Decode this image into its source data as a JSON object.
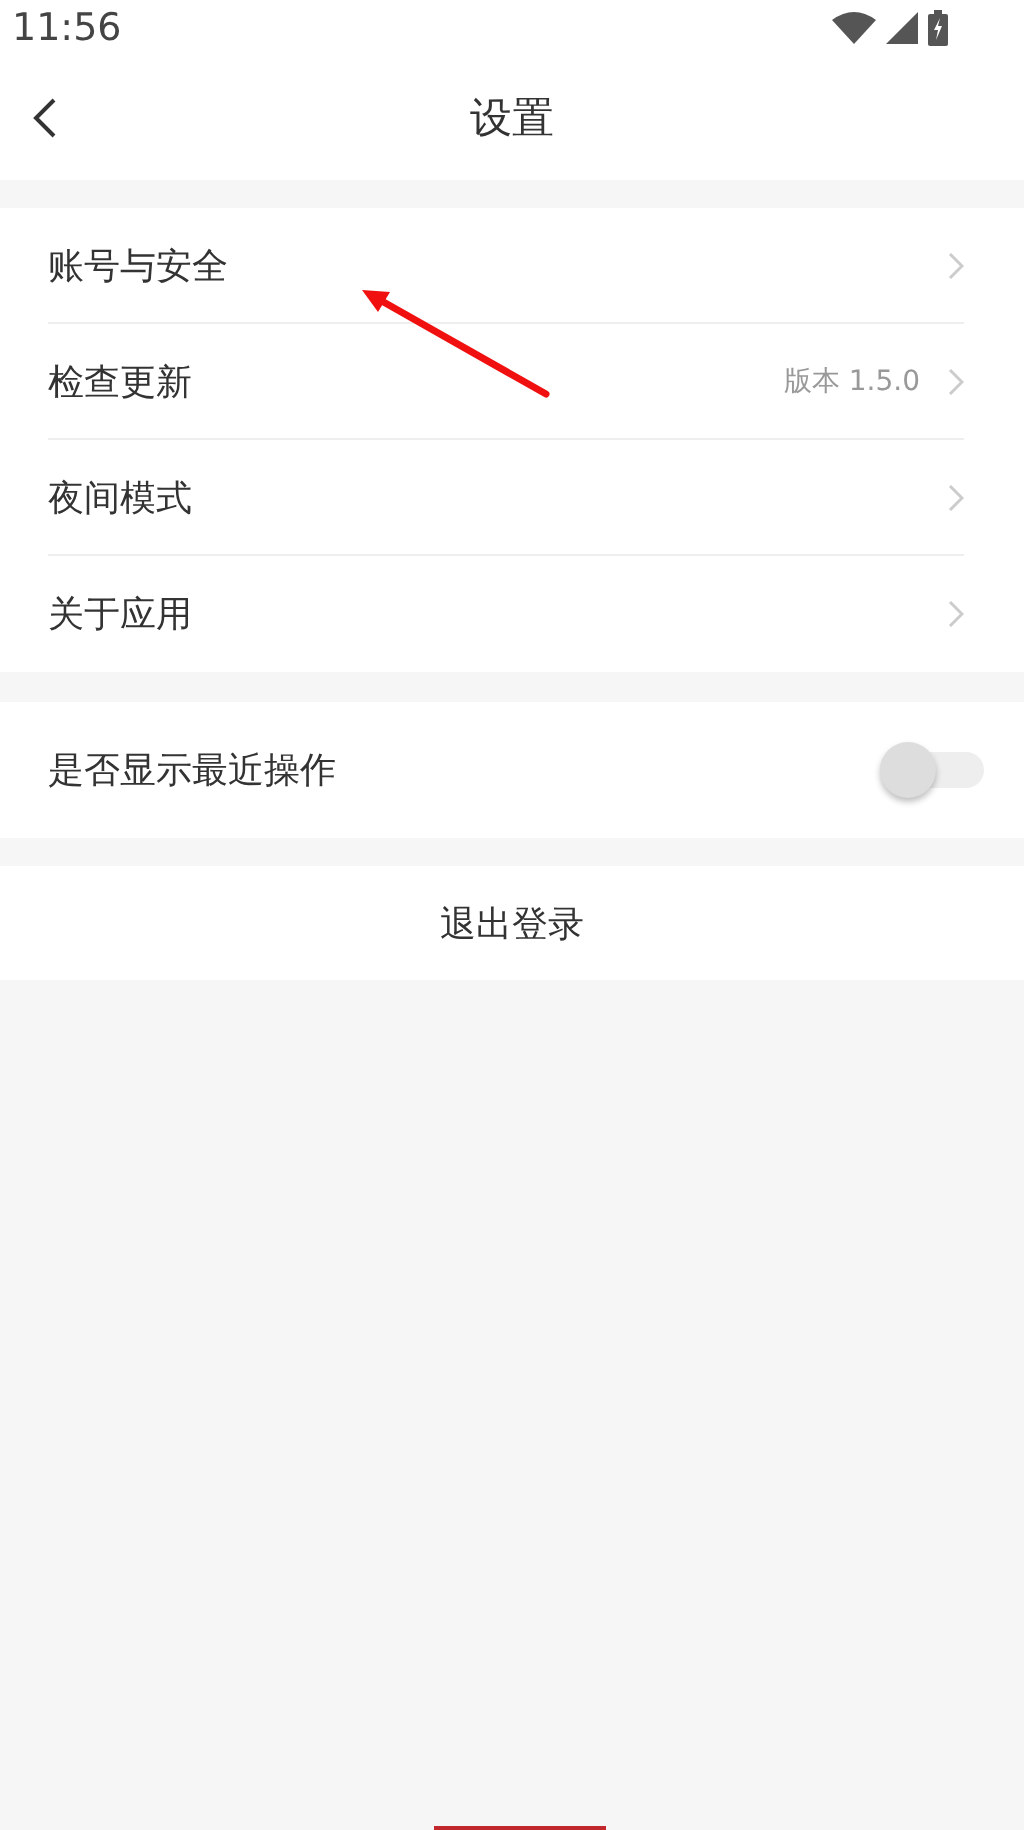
{
  "status_bar": {
    "time": "11:56"
  },
  "header": {
    "title": "设置"
  },
  "menu": [
    {
      "label": "账号与安全"
    },
    {
      "label": "检查更新",
      "value": "版本 1.5.0"
    },
    {
      "label": "夜间模式"
    },
    {
      "label": "关于应用"
    }
  ],
  "toggle_row": {
    "label": "是否显示最近操作",
    "on": false
  },
  "logout": {
    "label": "退出登录"
  }
}
